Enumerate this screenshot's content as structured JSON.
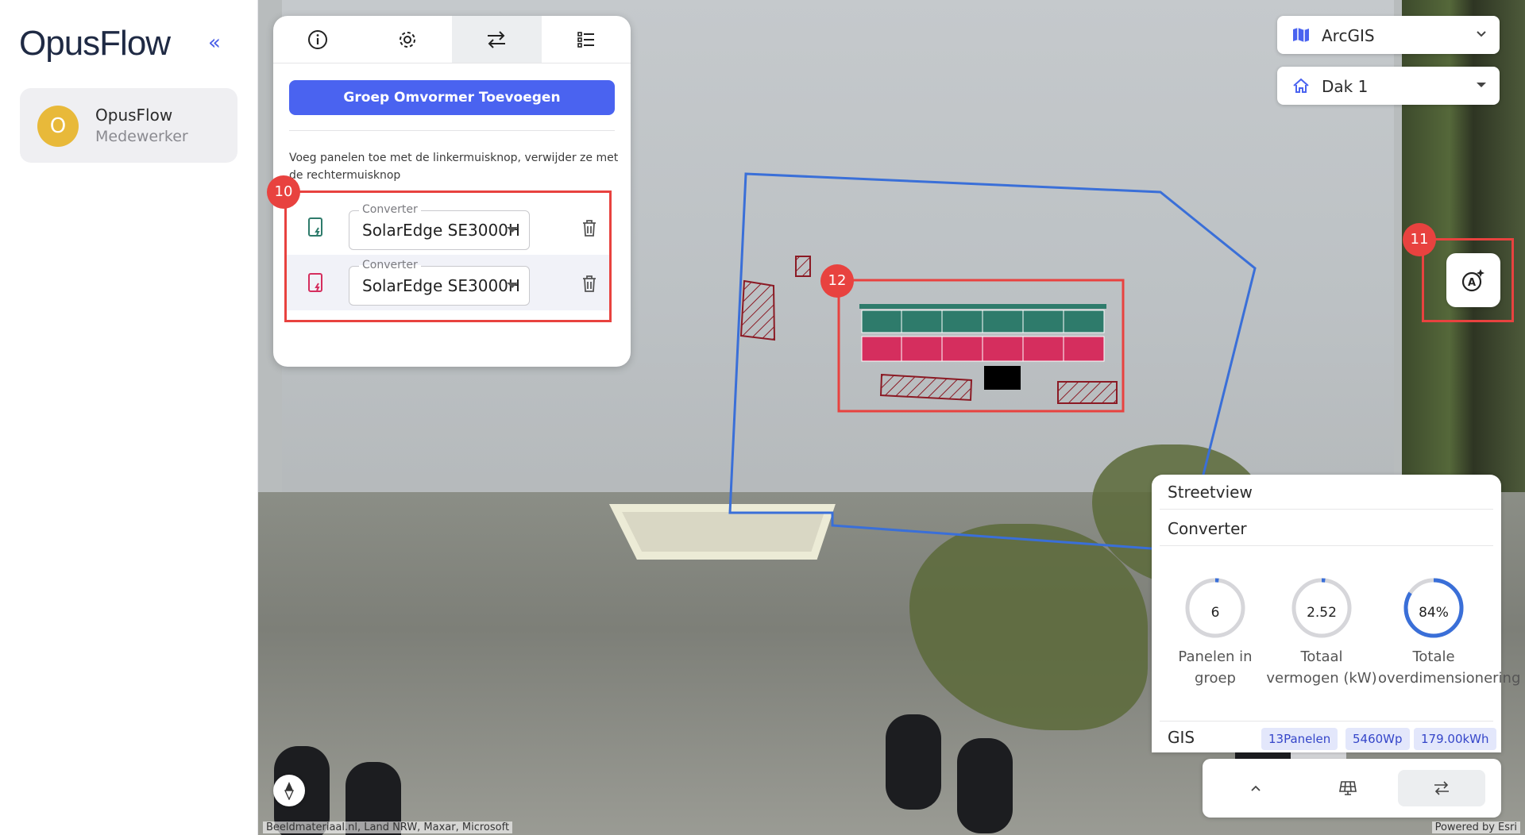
{
  "brand": {
    "logo": "OpusFlow"
  },
  "sidebar": {
    "user": {
      "initial": "O",
      "name": "OpusFlow",
      "role": "Medewerker"
    }
  },
  "toolbar": {
    "tabs": [
      {
        "icon": "info-icon"
      },
      {
        "icon": "gear-icon"
      },
      {
        "icon": "swap-arrows-icon",
        "active": true
      },
      {
        "icon": "list-icon"
      }
    ],
    "add_group_label": "Groep Omvormer Toevoegen",
    "hint": "Voeg panelen toe met de linkermuisknop, verwijder ze met de rechtermuisknop",
    "converters": [
      {
        "label": "Converter",
        "value": "SolarEdge SE3000H",
        "color": "#2e7b6b"
      },
      {
        "label": "Converter",
        "value": "SolarEdge SE3000H",
        "color": "#d52e5e"
      }
    ]
  },
  "badges": {
    "groups": "10",
    "ai": "11",
    "panels": "12"
  },
  "map": {
    "basemap": "ArcGIS",
    "roof": "Dak 1",
    "attribution": "Beeldmateriaal.nl, Land NRW, Maxar, Microsoft",
    "powered_by": "Powered by Esri"
  },
  "info_panel": {
    "streetview": "Streetview",
    "converter": "Converter",
    "stats": [
      {
        "value": "6",
        "label": "Panelen in groep",
        "progress": 0.02
      },
      {
        "value": "2.52",
        "label": "Totaal vermogen (kW)",
        "progress": 0.02
      },
      {
        "value": "84%",
        "label": "Totale overdimensionering",
        "progress": 0.84
      }
    ],
    "gis_label": "GIS",
    "chips": [
      "13Panelen",
      "5460Wp",
      "179.00kWh"
    ]
  },
  "colors": {
    "accent": "#4a63f0",
    "panel_green": "#2e7b6b",
    "panel_red": "#d52e5e",
    "highlight": "#e8423f",
    "outline": "#3a6fd8"
  }
}
